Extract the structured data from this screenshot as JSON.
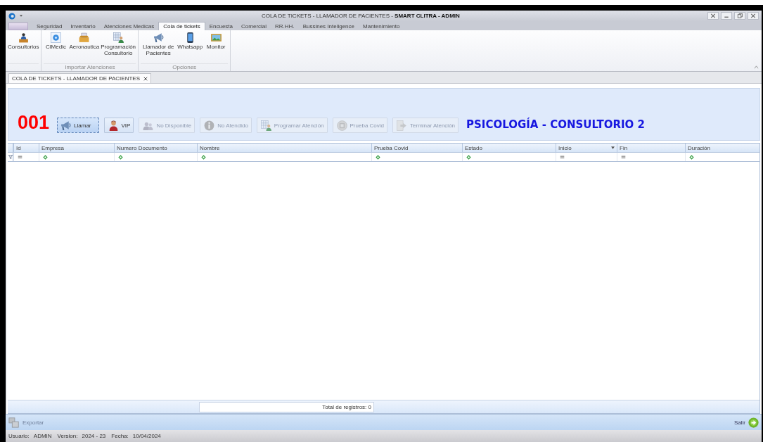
{
  "window": {
    "title": "COLA DE TICKETS - LLAMADOR DE PACIENTES - **SMART CLITRA - ADMIN**"
  },
  "menu_tabs": [
    {
      "label": "Seguridad",
      "selected": false
    },
    {
      "label": "Inventario",
      "selected": false
    },
    {
      "label": "Atenciones Medicas",
      "selected": false
    },
    {
      "label": "Cola de tickets",
      "selected": true
    },
    {
      "label": "Encuesta",
      "selected": false
    },
    {
      "label": "Comercial",
      "selected": false
    },
    {
      "label": "RR.HH.",
      "selected": false
    },
    {
      "label": "Bussines Inteligence",
      "selected": false
    },
    {
      "label": "Mantenimiento",
      "selected": false
    }
  ],
  "ribbon_groups": [
    {
      "items": [
        {
          "label": "Consultorios",
          "kind": "desk"
        }
      ]
    },
    {
      "label": "Importar Atenciones",
      "items": [
        {
          "label": "ClMedic",
          "kind": "disc"
        },
        {
          "label": "Aeronautica",
          "kind": "tray"
        },
        {
          "label": "Programación Consultorio",
          "kind": "schedule"
        }
      ]
    },
    {
      "label": "Opciones",
      "items": [
        {
          "label": "Llamador de Pacientes",
          "kind": "megaphone"
        },
        {
          "label": "Whatsapp",
          "kind": "phone"
        },
        {
          "label": "Monitor",
          "kind": "monitor"
        }
      ]
    }
  ],
  "document_tab": {
    "label": "COLA DE TICKETS - LLAMADOR DE PACIENTES"
  },
  "ticket_number": "001",
  "actions": [
    {
      "label": "Llamar",
      "kind": "megaphone",
      "disabled": false,
      "selected": true
    },
    {
      "label": "VIP",
      "kind": "person",
      "disabled": false,
      "selected": false
    },
    {
      "label": "No Disponible",
      "kind": "people",
      "disabled": true,
      "selected": false
    },
    {
      "label": "No Atendido",
      "kind": "info",
      "disabled": true,
      "selected": false
    },
    {
      "label": "Programar Atención",
      "kind": "schedule",
      "disabled": true,
      "selected": false
    },
    {
      "label": "Prueba Covid",
      "kind": "test",
      "disabled": true,
      "selected": false
    },
    {
      "label": "Terminar Atención",
      "kind": "exit",
      "disabled": true,
      "selected": false
    }
  ],
  "room": "PSICOLOGÍA  - CONSULTORIO 2",
  "table": {
    "columns": [
      {
        "label": "Id",
        "kind": "equals"
      },
      {
        "label": "Empresa",
        "kind": "contains"
      },
      {
        "label": "Numero Documento",
        "kind": "contains"
      },
      {
        "label": "Nombre",
        "kind": "contains"
      },
      {
        "label": "Prueba Covid",
        "kind": "contains"
      },
      {
        "label": "Estado",
        "kind": "contains"
      },
      {
        "label": "Inicio",
        "kind": "equals",
        "sorted": true
      },
      {
        "label": "Fin",
        "kind": "equals"
      },
      {
        "label": "Duración",
        "kind": "contains"
      }
    ],
    "total": "Total de registros: 0"
  },
  "bottom_bar": {
    "export": {
      "label": "Exportar",
      "disabled": true
    },
    "exit": {
      "label": "Salir"
    }
  },
  "status_bar": [
    {
      "label": "Usuario:",
      "value": "ADMIN"
    },
    {
      "label": "Version:",
      "value": "2024 - 23"
    },
    {
      "label": "Fecha:",
      "value": "10/04/2024"
    }
  ]
}
